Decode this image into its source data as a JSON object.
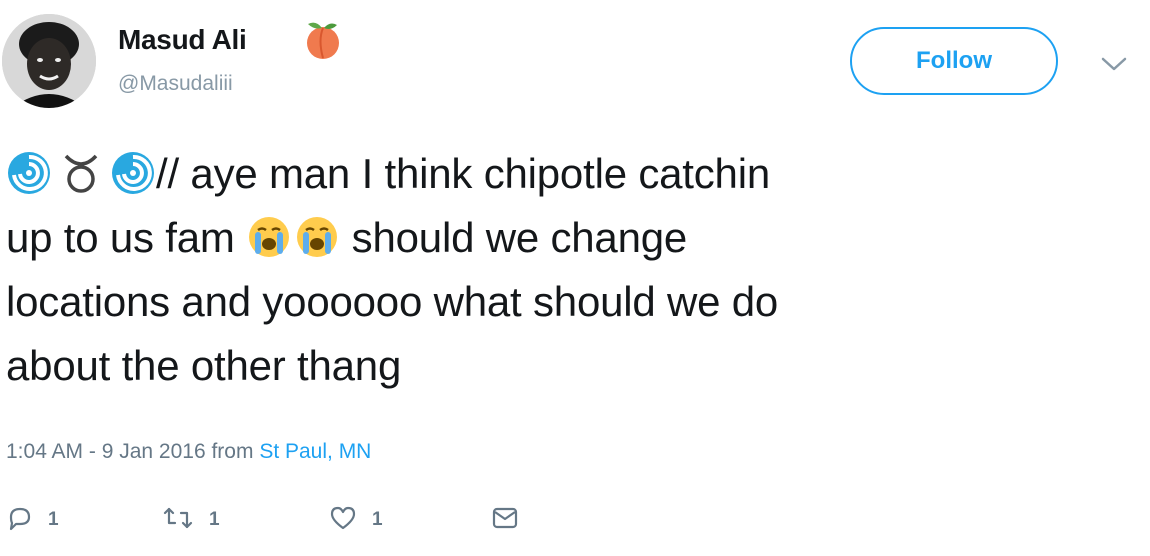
{
  "tweet": {
    "display_name": "Masud Ali",
    "name_emoji": "peach-emoji",
    "handle": "@Masudaliii",
    "follow_label": "Follow",
    "text_parts": {
      "p1": "// aye man I think chipotle catchin",
      "p2": "up to us fam ",
      "p3": " should we change",
      "p4": "locations and yoooooo what should we do",
      "p5": "about the other thang"
    },
    "leading_emojis": [
      "cyclone-emoji",
      "taurus-emoji",
      "cyclone-emoji"
    ],
    "inline_emojis": [
      "loudly-crying-face-emoji",
      "loudly-crying-face-emoji"
    ],
    "timestamp": "1:04 AM - 9 Jan 2016 from ",
    "location": "St Paul, MN",
    "reply_count": "1",
    "retweet_count": "1",
    "like_count": "1",
    "colors": {
      "accent": "#1da1f2",
      "text": "#14171a",
      "muted": "#657786"
    }
  }
}
